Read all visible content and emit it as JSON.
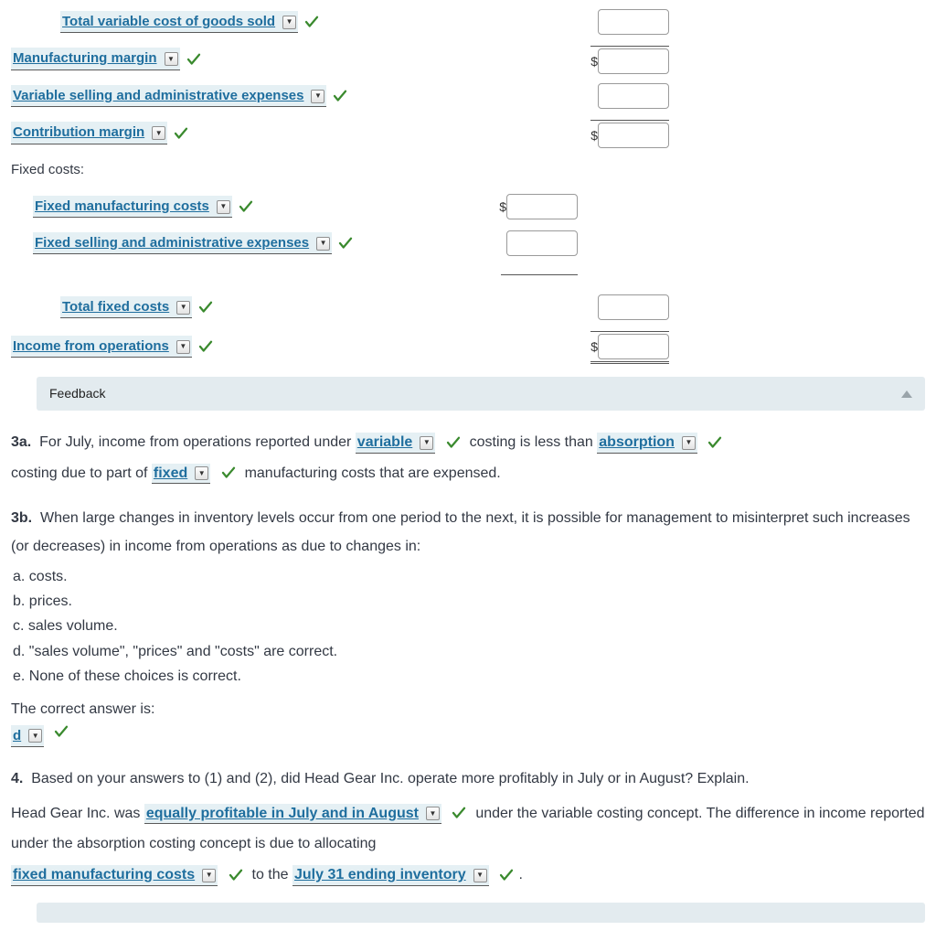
{
  "statement": {
    "rows": [
      {
        "id": "total-var-cogs",
        "label": "Total variable cost of goods sold",
        "indent": 2,
        "checked": true,
        "dollar": false,
        "col": 3
      },
      {
        "id": "mfg-margin",
        "label": "Manufacturing margin",
        "indent": 0,
        "checked": true,
        "dollar": true,
        "col": 3
      },
      {
        "id": "var-sell-admin",
        "label": "Variable selling and administrative expenses",
        "indent": 0,
        "checked": true,
        "dollar": false,
        "col": 3
      },
      {
        "id": "contribution-margin",
        "label": "Contribution margin",
        "indent": 0,
        "checked": true,
        "dollar": true,
        "col": 3
      },
      {
        "id": "fixed-heading",
        "label": "Fixed costs:",
        "plain": true,
        "indent": 0
      },
      {
        "id": "fixed-mfg-costs",
        "label": "Fixed manufacturing costs",
        "indent": 1,
        "checked": true,
        "dollar": true,
        "col": 2
      },
      {
        "id": "fixed-sell-admin",
        "label": "Fixed selling and administrative expenses",
        "indent": 1,
        "checked": true,
        "dollar": false,
        "col": 2,
        "sumBelow": true
      },
      {
        "id": "total-fixed",
        "label": "Total fixed costs",
        "indent": 2,
        "checked": true,
        "dollar": false,
        "col": 3
      },
      {
        "id": "income-ops",
        "label": "Income from operations",
        "indent": 0,
        "checked": true,
        "dollar": true,
        "col": 3,
        "final": true
      }
    ]
  },
  "feedback": {
    "label": "Feedback"
  },
  "q3a": {
    "prefix": "3a.",
    "t1": "For July, income from operations reported under",
    "dd1": "variable",
    "t2": "costing is less than",
    "dd2": "absorption",
    "t3": "costing due to part of",
    "dd3": "fixed",
    "t4": "manufacturing costs that are expensed."
  },
  "q3b": {
    "prefix": "3b.",
    "prompt": "When large changes in inventory levels occur from one period to the next, it is possible for management to misinterpret such increases (or decreases) in income from operations as due to changes in:",
    "options": [
      "a. costs.",
      "b. prices.",
      "c. sales volume.",
      "d. \"sales volume\", \"prices\" and \"costs\" are correct.",
      "e. None of these choices is correct."
    ],
    "answerLabel": "The correct answer is:",
    "answer": "d"
  },
  "q4": {
    "prefix": "4.",
    "prompt": "Based on your answers to (1) and (2), did Head Gear Inc. operate more profitably in July or in August? Explain.",
    "t1": "Head Gear Inc. was",
    "dd1": "equally profitable in July and in August",
    "t2": "under the variable costing concept. The difference in income reported under the absorption costing concept is due to allocating",
    "dd2": "fixed manufacturing costs",
    "t3": "to the",
    "dd3": "July 31 ending inventory",
    "t4": "."
  }
}
